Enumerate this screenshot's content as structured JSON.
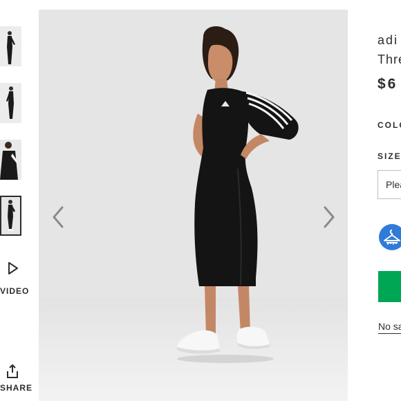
{
  "gallery": {
    "thumbnails": [
      {
        "label": "Thumbnail 1",
        "active": false
      },
      {
        "label": "Thumbnail 2",
        "active": false
      },
      {
        "label": "Thumbnail 3",
        "active": false
      },
      {
        "label": "Thumbnail 4",
        "active": true
      }
    ],
    "video_label": "VIDEO",
    "share_label": "SHARE"
  },
  "product": {
    "brand_text": "adi",
    "name_text": "Thre",
    "price_text": "$6",
    "colour_label": "COLO",
    "size_label": "SIZE",
    "size_select_value": "Plea",
    "save_link_text": "No sa"
  },
  "colors": {
    "accent_green": "#00a653",
    "fit_icon_blue": "#2f7bd8",
    "text_dark": "#2d2d2d",
    "image_bg": "#e6e6e6"
  },
  "icons": {
    "play": "play-icon",
    "share": "share-icon",
    "prev": "chevron-left-icon",
    "next": "chevron-right-icon",
    "fit": "hanger-icon"
  }
}
